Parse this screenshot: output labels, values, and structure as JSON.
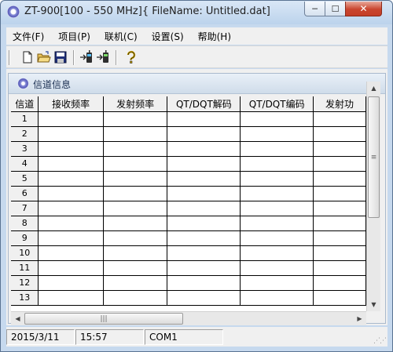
{
  "window": {
    "title": "ZT-900[100 - 550 MHz]{ FileName: Untitled.dat]",
    "minimize_glyph": "─",
    "maximize_glyph": "☐",
    "close_glyph": "✕"
  },
  "menu": [
    {
      "label": "文件(F)"
    },
    {
      "label": "项目(P)"
    },
    {
      "label": "联机(C)"
    },
    {
      "label": "设置(S)"
    },
    {
      "label": "帮助(H)"
    }
  ],
  "toolbar": {
    "icons": [
      "new-file-icon",
      "open-folder-icon",
      "save-disk-icon",
      "read-from-radio-icon",
      "write-to-radio-icon",
      "help-question-icon"
    ]
  },
  "panel": {
    "title": "信道信息"
  },
  "grid": {
    "columns": [
      "信道",
      "接收频率",
      "发射频率",
      "QT/DQT解码",
      "QT/DQT编码",
      "发射功"
    ],
    "rows": [
      "1",
      "2",
      "3",
      "4",
      "5",
      "6",
      "7",
      "8",
      "9",
      "10",
      "11",
      "12",
      "13"
    ]
  },
  "scrollbars": {
    "vertical_grip": "≡",
    "horizontal_grip": "|||",
    "up_arrow": "▲",
    "down_arrow": "▼",
    "left_arrow": "◀",
    "right_arrow": "▶"
  },
  "status": {
    "date": "2015/3/11",
    "time": "15:57",
    "port": "COM1"
  }
}
